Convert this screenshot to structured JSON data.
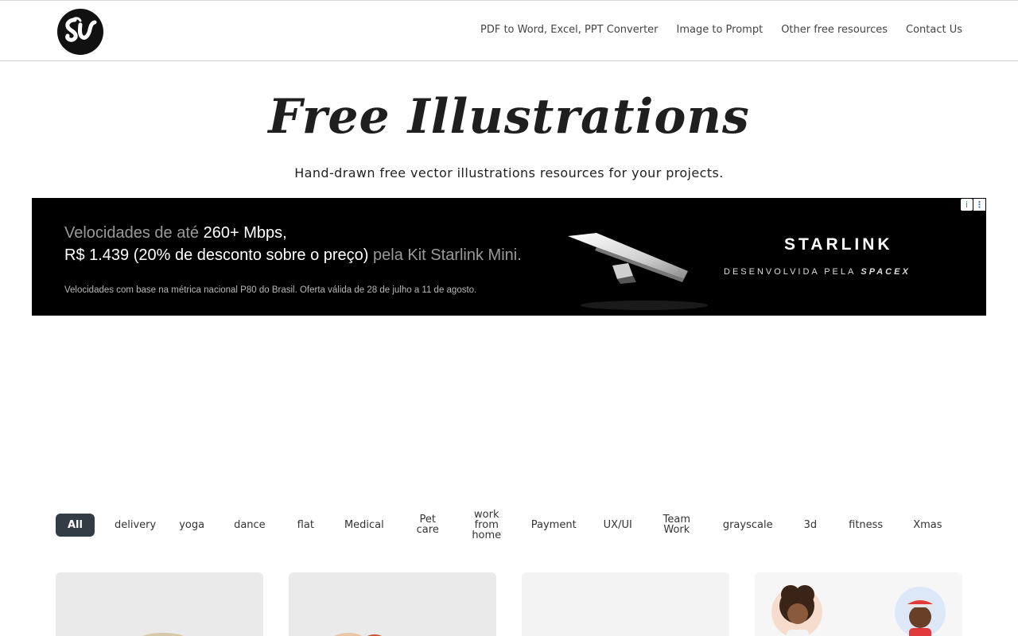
{
  "header": {
    "logo_text": "SU",
    "nav": [
      "PDF to Word, Excel, PPT Converter",
      "Image to Prompt",
      "Other free resources",
      "Contact Us"
    ]
  },
  "hero": {
    "title": "Free Illustrations",
    "subtitle": "Hand-drawn free vector illustrations resources for your projects."
  },
  "ad": {
    "line1_a": "Velocidades de até ",
    "line1_b": "260+ Mbps,",
    "line2_a": "R$ 1.439 (20% de desconto sobre o preço) ",
    "line2_b": "pela Kit Starlink Mini.",
    "fine_print": "Velocidades com base na métrica nacional P80 do Brasil. Oferta válida de 28 de julho a 11 de agosto.",
    "brand": "STARLINK",
    "tagline": "DESENVOLVIDA PELA",
    "tagline_brand": "SPACEX",
    "info_icon": "info-icon",
    "menu_icon": "kebab-icon"
  },
  "tags": [
    "All",
    "delivery",
    "yoga",
    "dance",
    "flat",
    "Medical",
    "Pet care",
    "work from home",
    "Payment",
    "UX/UI",
    "Team Work",
    "grayscale",
    "3d",
    "fitness",
    "Xmas"
  ],
  "colors": {
    "active_tag_bg": "#333c45",
    "ad_bg": "#000000",
    "card_bg": "#eaeaea"
  }
}
